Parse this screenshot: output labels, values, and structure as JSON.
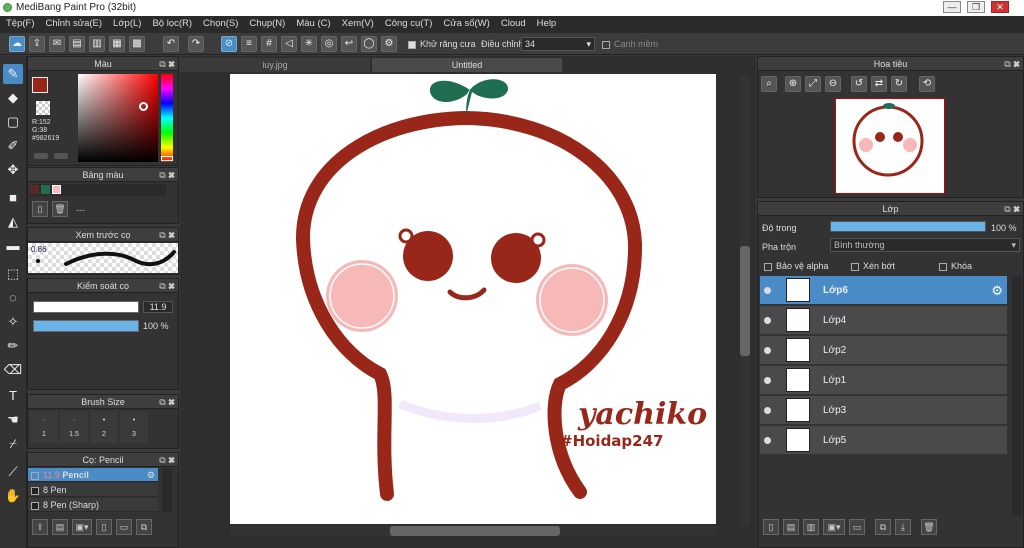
{
  "window": {
    "title": "MediBang Paint Pro (32bit)"
  },
  "menu": [
    "Tệp(F)",
    "Chỉnh sửa(E)",
    "Lớp(L)",
    "Bộ lọc(R)",
    "Chọn(S)",
    "Chụp(N)",
    "Màu (C)",
    "Xem(V)",
    "Công cụ(T)",
    "Cửa sổ(W)",
    "Cloud",
    "Help"
  ],
  "toolbar": {
    "antialias_label": "Khử răng cưa",
    "correction_label": "Điều chỉnh",
    "correction_value": "34",
    "sharp_label": "Cạnh mềm"
  },
  "color_panel": {
    "title": "Màu",
    "r": "R:152",
    "g": "G:38",
    "b": "B:25",
    "hex": "#982619",
    "fg": "#982619"
  },
  "palette_panel": {
    "title": "Bảng màu",
    "placeholder": "---"
  },
  "brush_preview": {
    "title": "Xem trước cọ",
    "size": "0.86"
  },
  "brush_control": {
    "title": "Kiểm soát cọ",
    "size": "11.9",
    "opacity": "100 %",
    "opacity_pct": 100
  },
  "brush_size": {
    "title": "Brush Size",
    "sizes": [
      "1",
      "1.5",
      "2",
      "3"
    ]
  },
  "brush_list": {
    "title": "Cọ: Pencil",
    "items": [
      {
        "size": "11.9",
        "name": "Pencil"
      },
      {
        "size": "8",
        "name": "Pen"
      },
      {
        "size": "8",
        "name": "Pen (Sharp)"
      }
    ]
  },
  "tabs": [
    "iuy.jpg",
    "Untitled"
  ],
  "artwork": {
    "text1": "yachiko",
    "text2": "#Hoidap247",
    "main_color": "#982619",
    "leaf_color": "#1f6e52",
    "blush_color": "#f7b8b8"
  },
  "navigator": {
    "title": "Hoa tiêu"
  },
  "layer_panel": {
    "title": "Lớp",
    "opacity_label": "Độ trong",
    "opacity_value": "100 %",
    "opacity_pct": 100,
    "blend_label": "Pha trộn",
    "blend_value": "Bình thường",
    "protect_alpha": "Bảo vệ alpha",
    "clipping": "Xén bớt",
    "lock": "Khóa",
    "layers": [
      "Lớp6",
      "Lớp4",
      "Lớp2",
      "Lớp1",
      "Lớp3",
      "Lớp5"
    ]
  }
}
